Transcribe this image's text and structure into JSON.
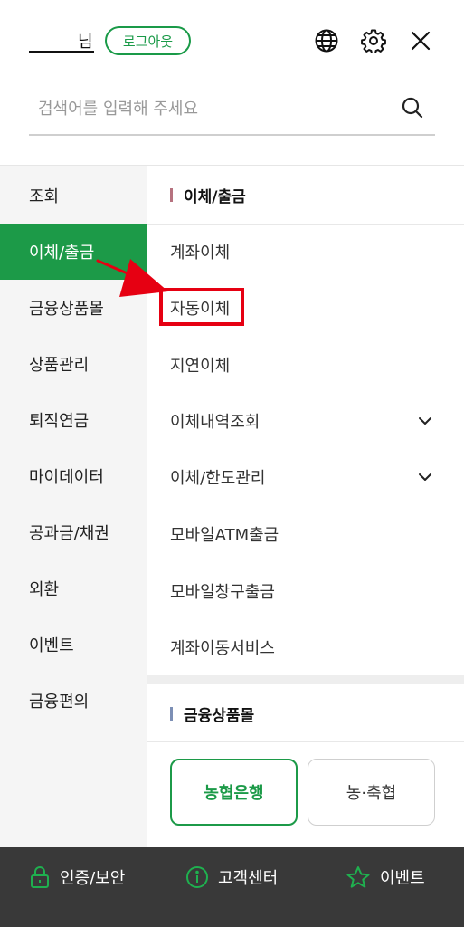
{
  "header": {
    "user_suffix": "님",
    "logout_label": "로그아웃",
    "icons": [
      "globe-icon",
      "gear-icon",
      "close-icon"
    ]
  },
  "search": {
    "placeholder": "검색어를 입력해 주세요",
    "value": ""
  },
  "left_nav": {
    "items": [
      {
        "label": "조회",
        "active": false
      },
      {
        "label": "이체/출금",
        "active": true
      },
      {
        "label": "금융상품몰",
        "active": false
      },
      {
        "label": "상품관리",
        "active": false
      },
      {
        "label": "퇴직연금",
        "active": false
      },
      {
        "label": "마이데이터",
        "active": false
      },
      {
        "label": "공과금/채권",
        "active": false
      },
      {
        "label": "외환",
        "active": false
      },
      {
        "label": "이벤트",
        "active": false
      },
      {
        "label": "금융편의",
        "active": false
      }
    ]
  },
  "right_panel": {
    "section1": {
      "title": "이체/출금",
      "items": [
        {
          "label": "계좌이체",
          "expandable": false
        },
        {
          "label": "자동이체",
          "expandable": false,
          "highlighted": true
        },
        {
          "label": "지연이체",
          "expandable": false
        },
        {
          "label": "이체내역조회",
          "expandable": true
        },
        {
          "label": "이체/한도관리",
          "expandable": true
        },
        {
          "label": "모바일ATM출금",
          "expandable": false
        },
        {
          "label": "모바일창구출금",
          "expandable": false
        },
        {
          "label": "계좌이동서비스",
          "expandable": false
        }
      ]
    },
    "section2": {
      "title": "금융상품몰",
      "buttons": [
        {
          "label": "농협은행",
          "selected": true
        },
        {
          "label": "농·축협",
          "selected": false
        }
      ]
    }
  },
  "bottom_bar": {
    "items": [
      {
        "label": "인증/보안",
        "icon": "lock-icon"
      },
      {
        "label": "고객센터",
        "icon": "info-icon"
      },
      {
        "label": "이벤트",
        "icon": "star-icon"
      }
    ]
  },
  "colors": {
    "brand_green": "#1c9a48",
    "highlight_red": "#e60012",
    "bottom_bar": "#393939",
    "section1_bar": "#b6727f",
    "section2_bar": "#7c8fb5"
  }
}
